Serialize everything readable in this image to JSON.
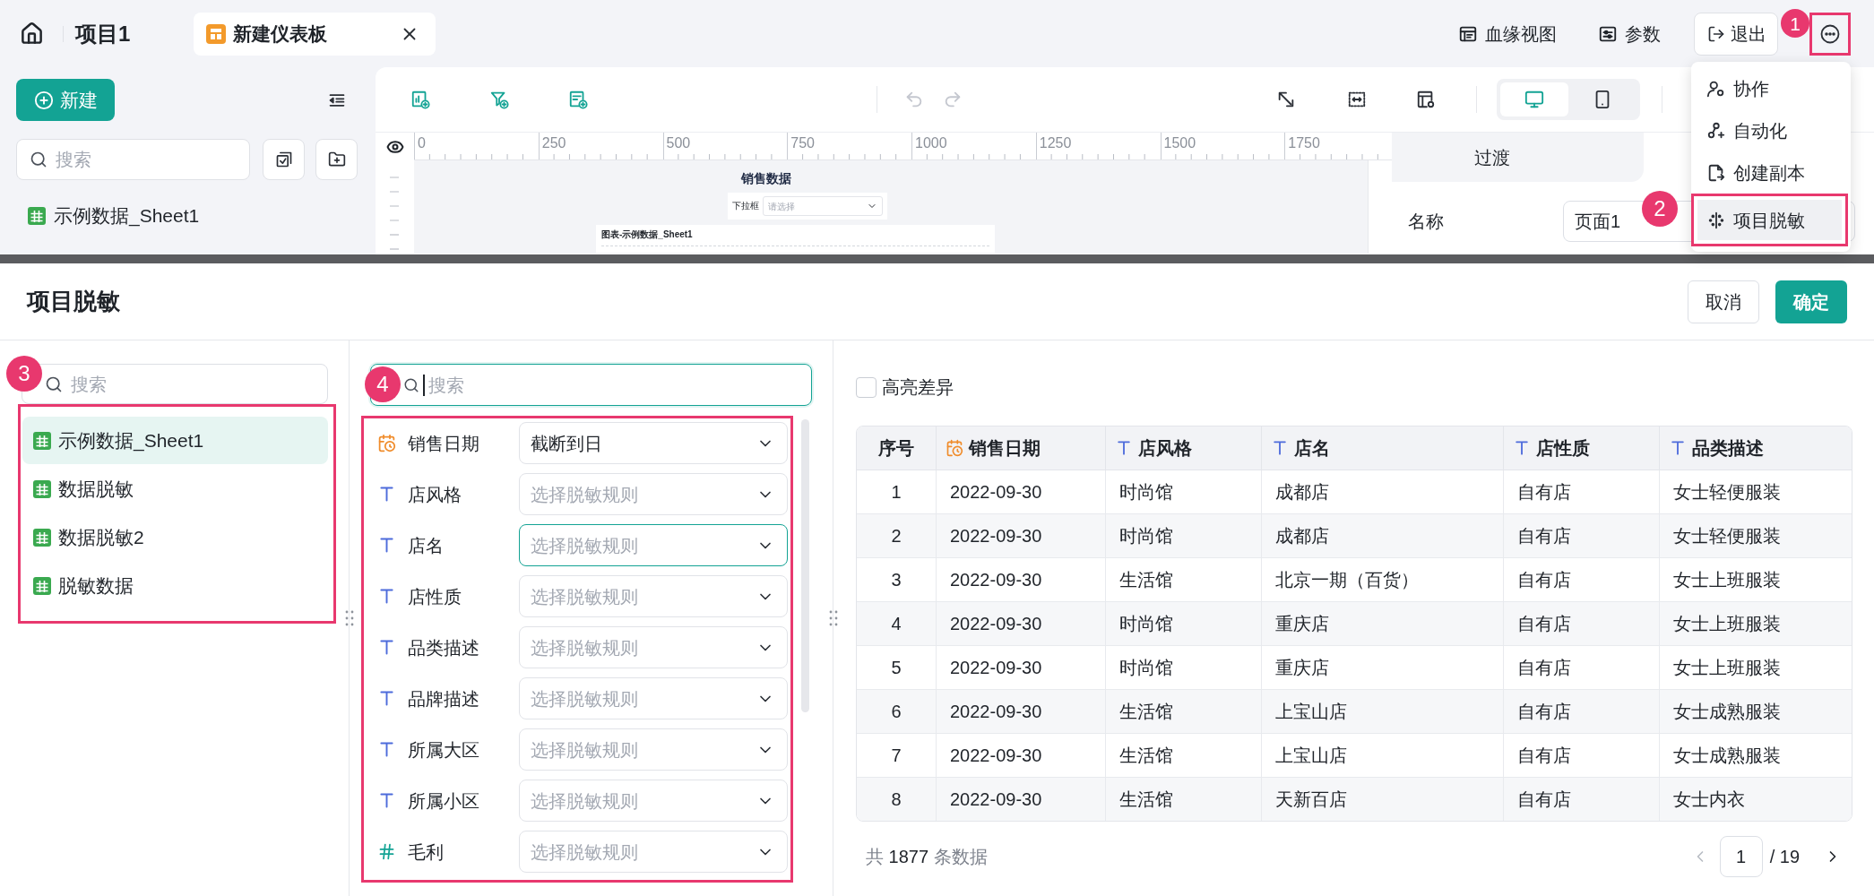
{
  "header": {
    "project_title": "项目1",
    "tabs": [
      {
        "label": "新建仪表板",
        "selected": true
      }
    ],
    "actions": [
      {
        "kind": "lineage",
        "label": "血缘视图"
      },
      {
        "kind": "parameters",
        "label": "参数"
      }
    ],
    "exit_button": "退出",
    "more_button": {
      "callout": "1"
    }
  },
  "sidebar": {
    "new_button": "新建",
    "search": {
      "placeholder": "搜索"
    },
    "items": [
      {
        "label": "示例数据_Sheet1"
      }
    ]
  },
  "toolbar": {
    "history": [
      {
        "kind": "undo",
        "disabled": true
      },
      {
        "kind": "redo",
        "disabled": true
      }
    ],
    "devices": [
      {
        "kind": "desktop",
        "selected": true
      },
      {
        "kind": "mobile",
        "selected": false
      }
    ]
  },
  "canvas": {
    "ruler_labels": [
      "0",
      "250",
      "500",
      "750",
      "1000",
      "1250",
      "1500",
      "1750"
    ],
    "page": {
      "title": "销售数据",
      "filter": {
        "label": "下拉框",
        "placeholder": "请选择"
      },
      "chart_title": "图表-示例数据_Sheet1"
    }
  },
  "properties": {
    "tabs": [
      {
        "label": "过渡",
        "selected": false
      }
    ],
    "fields": [
      {
        "label": "名称",
        "value": "页面1"
      }
    ]
  },
  "more_menu": {
    "items": [
      {
        "kind": "collaborate",
        "label": "协作",
        "selected": false
      },
      {
        "kind": "automation",
        "label": "自动化",
        "selected": false
      },
      {
        "kind": "duplicate",
        "label": "创建副本",
        "selected": false
      },
      {
        "kind": "desensitize",
        "label": "项目脱敏",
        "selected": true,
        "callout": "2"
      }
    ]
  },
  "dialog": {
    "title": "项目脱敏",
    "buttons": [
      {
        "kind": "secondary",
        "label": "取消"
      },
      {
        "kind": "primary",
        "label": "确定"
      }
    ],
    "datasets": {
      "callout": "3",
      "search": {
        "placeholder": "搜索"
      },
      "items": [
        {
          "label": "示例数据_Sheet1",
          "selected": true
        },
        {
          "label": "数据脱敏",
          "selected": false
        },
        {
          "label": "数据脱敏2",
          "selected": false
        },
        {
          "label": "脱敏数据",
          "selected": false
        }
      ]
    },
    "fields": {
      "callout": "4",
      "search": {
        "placeholder": "搜索",
        "focused": true
      },
      "items": [
        {
          "kind": "date",
          "name": "销售日期",
          "value": "截断到日",
          "focused": false
        },
        {
          "kind": "text",
          "name": "店风格",
          "placeholder": "选择脱敏规则",
          "focused": false
        },
        {
          "kind": "text",
          "name": "店名",
          "placeholder": "选择脱敏规则",
          "focused": true
        },
        {
          "kind": "text",
          "name": "店性质",
          "placeholder": "选择脱敏规则",
          "focused": false
        },
        {
          "kind": "text",
          "name": "品类描述",
          "placeholder": "选择脱敏规则",
          "focused": false
        },
        {
          "kind": "text",
          "name": "品牌描述",
          "placeholder": "选择脱敏规则",
          "focused": false
        },
        {
          "kind": "text",
          "name": "所属大区",
          "placeholder": "选择脱敏规则",
          "focused": false
        },
        {
          "kind": "text",
          "name": "所属小区",
          "placeholder": "选择脱敏规则",
          "focused": false
        },
        {
          "kind": "number",
          "name": "毛利",
          "placeholder": "选择脱敏规则",
          "focused": false
        }
      ]
    },
    "preview": {
      "highlight_diff": {
        "label": "高亮差异",
        "checked": false
      },
      "table": {
        "columns": [
          {
            "kind": "index",
            "label": "序号"
          },
          {
            "kind": "date",
            "label": "销售日期"
          },
          {
            "kind": "text",
            "label": "店风格"
          },
          {
            "kind": "text",
            "label": "店名"
          },
          {
            "kind": "text",
            "label": "店性质"
          },
          {
            "kind": "text",
            "label": "品类描述"
          }
        ],
        "rows": [
          [
            "1",
            "2022-09-30",
            "时尚馆",
            "成都店",
            "自有店",
            "女士轻便服装"
          ],
          [
            "2",
            "2022-09-30",
            "时尚馆",
            "成都店",
            "自有店",
            "女士轻便服装"
          ],
          [
            "3",
            "2022-09-30",
            "生活馆",
            "北京一期（百货）",
            "自有店",
            "女士上班服装"
          ],
          [
            "4",
            "2022-09-30",
            "时尚馆",
            "重庆店",
            "自有店",
            "女士上班服装"
          ],
          [
            "5",
            "2022-09-30",
            "时尚馆",
            "重庆店",
            "自有店",
            "女士上班服装"
          ],
          [
            "6",
            "2022-09-30",
            "生活馆",
            "上宝山店",
            "自有店",
            "女士成熟服装"
          ],
          [
            "7",
            "2022-09-30",
            "生活馆",
            "上宝山店",
            "自有店",
            "女士成熟服装"
          ],
          [
            "8",
            "2022-09-30",
            "生活馆",
            "天新百店",
            "自有店",
            "女士内衣"
          ]
        ]
      },
      "footer": {
        "total": "共 **1877** 条数据",
        "page": "1",
        "page_count": "/ 19"
      }
    }
  }
}
